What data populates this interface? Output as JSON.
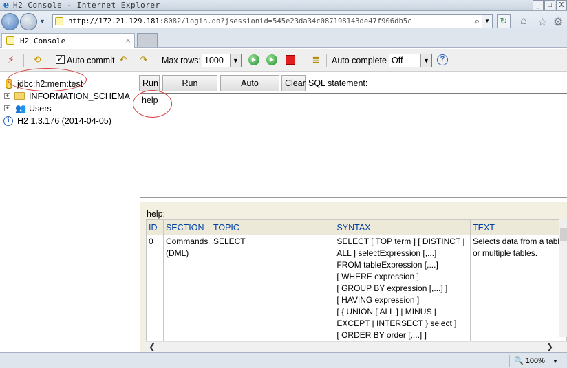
{
  "window": {
    "title": "H2 Console - Internet Explorer",
    "minimize": "_",
    "maximize": "□",
    "close": "X"
  },
  "address": {
    "host": "http://172.21.129.181",
    "path": ":8082/login.do?jsessionid=545e23da34c087198143de47f906db5c"
  },
  "tab": {
    "label": "H2 Console",
    "close": "×"
  },
  "toolbar": {
    "auto_commit": "Auto commit",
    "max_rows_label": "Max rows:",
    "max_rows_value": "1000",
    "auto_complete_label": "Auto complete",
    "auto_complete_value": "Off",
    "help_symbol": "?"
  },
  "tree": {
    "connection": "jdbc:h2:mem:test",
    "items": [
      {
        "label": "INFORMATION_SCHEMA"
      },
      {
        "label": "Users"
      }
    ],
    "version": "H2 1.3.176 (2014-04-05)"
  },
  "sql": {
    "buttons": {
      "run": "Run",
      "run_selected": "Run Selected",
      "auto_complete": "Auto complete",
      "clear": "Clear"
    },
    "statement_label": "SQL statement:",
    "editor_text": "help"
  },
  "result": {
    "query": "help;",
    "columns": [
      "ID",
      "SECTION",
      "TOPIC",
      "SYNTAX",
      "TEXT"
    ],
    "rows": [
      {
        "id": "0",
        "section_lines": [
          "Commands",
          "(DML)"
        ],
        "topic": "SELECT",
        "syntax_lines": [
          "SELECT [ TOP term ] [ DISTINCT |",
          "ALL ] selectExpression [,...]",
          "FROM tableExpression [,...]",
          "[ WHERE expression ]",
          "[ GROUP BY expression [,...] ]",
          "[ HAVING expression ]",
          "[ { UNION [ ALL ] | MINUS |",
          "EXCEPT | INTERSECT } select ]",
          "[ ORDER BY order [,...] ]"
        ],
        "text_lines": [
          "Selects data from a tabl",
          "or multiple tables."
        ]
      }
    ]
  },
  "status": {
    "zoom": "100%"
  }
}
